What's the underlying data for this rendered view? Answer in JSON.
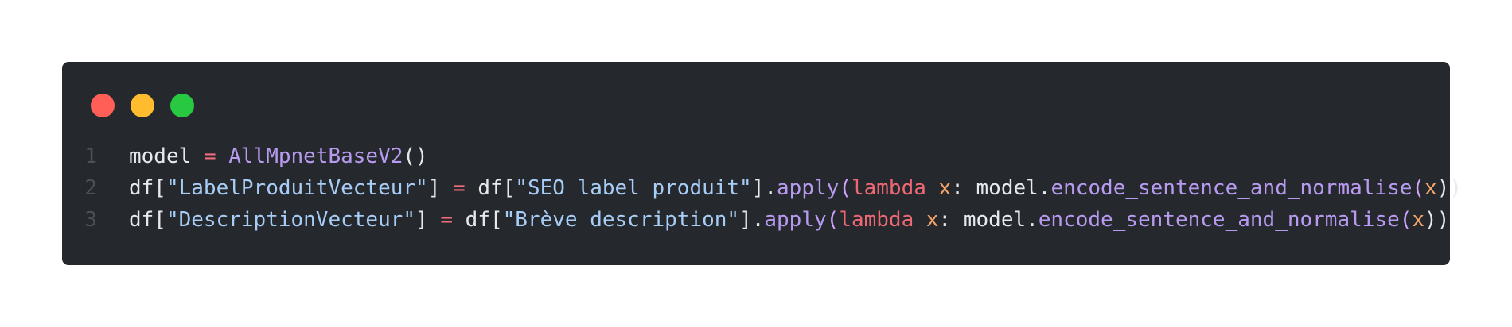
{
  "window": {
    "traffic_lights": [
      {
        "name": "close",
        "color": "#ff5f57"
      },
      {
        "name": "minimize",
        "color": "#febc2e"
      },
      {
        "name": "zoom",
        "color": "#28c840"
      }
    ]
  },
  "code": {
    "lines": [
      {
        "number": "1",
        "tokens": [
          {
            "text": "model",
            "kind": "plain"
          },
          {
            "text": " ",
            "kind": "plain"
          },
          {
            "text": "=",
            "kind": "op"
          },
          {
            "text": " ",
            "kind": "plain"
          },
          {
            "text": "AllMpnetBaseV2",
            "kind": "class"
          },
          {
            "text": "()",
            "kind": "plain"
          }
        ]
      },
      {
        "number": "2",
        "tokens": [
          {
            "text": "df[",
            "kind": "plain"
          },
          {
            "text": "\"LabelProduitVecteur\"",
            "kind": "str"
          },
          {
            "text": "]",
            "kind": "plain"
          },
          {
            "text": " ",
            "kind": "plain"
          },
          {
            "text": "=",
            "kind": "op"
          },
          {
            "text": " ",
            "kind": "plain"
          },
          {
            "text": "df[",
            "kind": "plain"
          },
          {
            "text": "\"SEO label produit\"",
            "kind": "str"
          },
          {
            "text": "].",
            "kind": "plain"
          },
          {
            "text": "apply",
            "kind": "method"
          },
          {
            "text": "(",
            "kind": "paren"
          },
          {
            "text": "lambda",
            "kind": "kw"
          },
          {
            "text": " ",
            "kind": "plain"
          },
          {
            "text": "x",
            "kind": "param"
          },
          {
            "text": ": model.",
            "kind": "plain"
          },
          {
            "text": "encode_sentence_and_normalise",
            "kind": "method"
          },
          {
            "text": "(",
            "kind": "paren"
          },
          {
            "text": "x",
            "kind": "param"
          },
          {
            "text": "))",
            "kind": "plain"
          }
        ]
      },
      {
        "number": "3",
        "tokens": [
          {
            "text": "df[",
            "kind": "plain"
          },
          {
            "text": "\"DescriptionVecteur\"",
            "kind": "str"
          },
          {
            "text": "]",
            "kind": "plain"
          },
          {
            "text": " ",
            "kind": "plain"
          },
          {
            "text": "=",
            "kind": "op"
          },
          {
            "text": " ",
            "kind": "plain"
          },
          {
            "text": "df[",
            "kind": "plain"
          },
          {
            "text": "\"Brève description\"",
            "kind": "str"
          },
          {
            "text": "].",
            "kind": "plain"
          },
          {
            "text": "apply",
            "kind": "method"
          },
          {
            "text": "(",
            "kind": "paren"
          },
          {
            "text": "lambda",
            "kind": "kw"
          },
          {
            "text": " ",
            "kind": "plain"
          },
          {
            "text": "x",
            "kind": "param"
          },
          {
            "text": ": model.",
            "kind": "plain"
          },
          {
            "text": "encode_sentence_and_normalise",
            "kind": "method"
          },
          {
            "text": "(",
            "kind": "paren"
          },
          {
            "text": "x",
            "kind": "param"
          },
          {
            "text": "))",
            "kind": "plain"
          }
        ]
      }
    ]
  }
}
